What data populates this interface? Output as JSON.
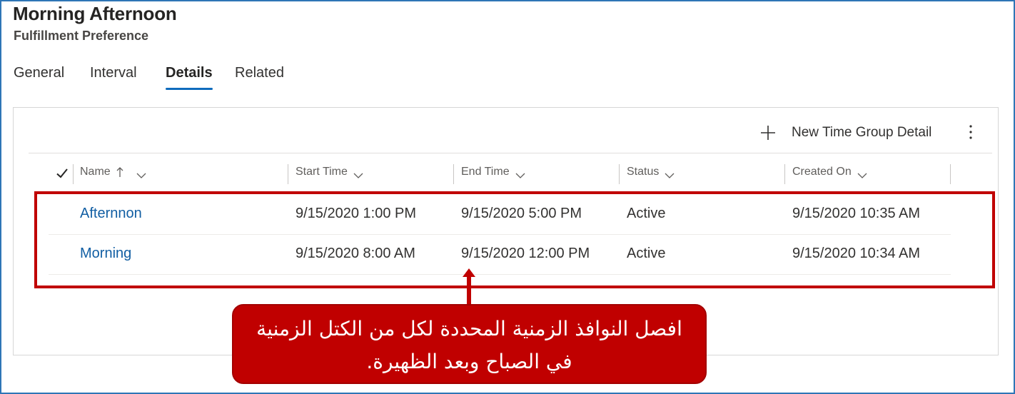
{
  "header": {
    "title": "Morning Afternoon",
    "subtitle": "Fulfillment Preference"
  },
  "tabs": [
    {
      "label": "General",
      "active": false
    },
    {
      "label": "Interval",
      "active": false
    },
    {
      "label": "Details",
      "active": true
    },
    {
      "label": "Related",
      "active": false
    }
  ],
  "commands": {
    "new_label": "New Time Group Detail",
    "new_icon": "plus-icon",
    "more_icon": "more-vertical-icon"
  },
  "grid": {
    "columns": [
      {
        "label": "Name",
        "sort": "ascending"
      },
      {
        "label": "Start Time"
      },
      {
        "label": "End Time"
      },
      {
        "label": "Status"
      },
      {
        "label": "Created On"
      }
    ],
    "rows": [
      {
        "name": "Afternnon",
        "start": "9/15/2020 1:00 PM",
        "end": "9/15/2020 5:00 PM",
        "status": "Active",
        "created": "9/15/2020 10:35 AM"
      },
      {
        "name": "Morning",
        "start": "9/15/2020 8:00 AM",
        "end": "9/15/2020 12:00 PM",
        "status": "Active",
        "created": "9/15/2020 10:34 AM"
      }
    ]
  },
  "annotation": {
    "text": "افصل النوافذ الزمنية المحددة لكل من الكتل الزمنية في الصباح وبعد الظهيرة."
  },
  "colors": {
    "accent": "#0f6cbd",
    "link": "#115ea3",
    "highlight": "#c00000",
    "frame": "#2e75b6"
  }
}
